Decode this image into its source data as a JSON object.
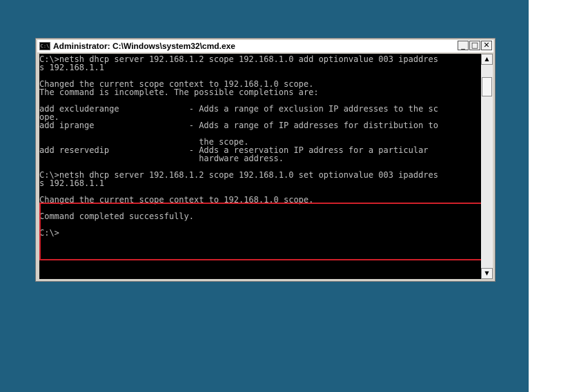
{
  "window": {
    "title": "Administrator: C:\\Windows\\system32\\cmd.exe",
    "icon_label": "C:\\",
    "minimize": "_",
    "maximize": "□",
    "close": "✕"
  },
  "console": {
    "lines": [
      "C:\\>netsh dhcp server 192.168.1.2 scope 192.168.1.0 add optionvalue 003 ipaddres",
      "s 192.168.1.1",
      "",
      "Changed the current scope context to 192.168.1.0 scope.",
      "The command is incomplete. The possible completions are:",
      "",
      "add excluderange              - Adds a range of exclusion IP addresses to the sc",
      "ope.",
      "add iprange                   - Adds a range of IP addresses for distribution to",
      "",
      "                                the scope.",
      "add reservedip                - Adds a reservation IP address for a particular",
      "                                hardware address.",
      "",
      "C:\\>netsh dhcp server 192.168.1.2 scope 192.168.1.0 set optionvalue 003 ipaddres",
      "s 192.168.1.1",
      "",
      "Changed the current scope context to 192.168.1.0 scope.",
      "",
      "Command completed successfully.",
      "",
      "C:\\>"
    ]
  },
  "scrollbar": {
    "up": "▲",
    "down": "▼"
  },
  "colors": {
    "desktop": "#1f5f7f",
    "console_bg": "#000000",
    "console_fg": "#c0c0c0",
    "highlight": "#d0202a"
  }
}
